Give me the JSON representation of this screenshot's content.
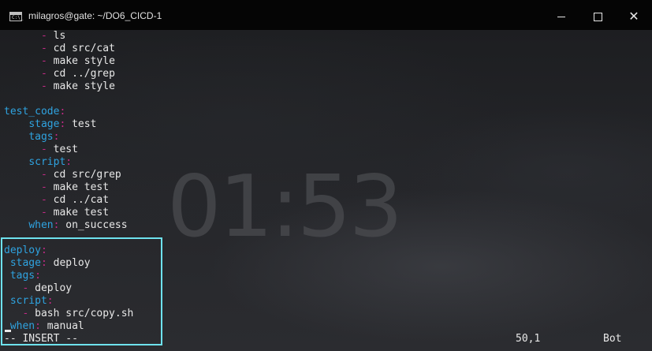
{
  "window": {
    "title": "milagros@gate: ~/DO6_CICD-1",
    "icon_label": "C:\\_",
    "buttons": {
      "minimize": "minimize",
      "maximize": "maximize",
      "close": "✕"
    }
  },
  "background": {
    "clock": "01:53"
  },
  "editor": {
    "lines": [
      [
        {
          "t": "      ",
          "c": "v"
        },
        {
          "t": "- ",
          "c": "d"
        },
        {
          "t": "ls",
          "c": "v"
        }
      ],
      [
        {
          "t": "      ",
          "c": "v"
        },
        {
          "t": "- ",
          "c": "d"
        },
        {
          "t": "cd src/cat",
          "c": "v"
        }
      ],
      [
        {
          "t": "      ",
          "c": "v"
        },
        {
          "t": "- ",
          "c": "d"
        },
        {
          "t": "make style",
          "c": "v"
        }
      ],
      [
        {
          "t": "      ",
          "c": "v"
        },
        {
          "t": "- ",
          "c": "d"
        },
        {
          "t": "cd ../grep",
          "c": "v"
        }
      ],
      [
        {
          "t": "      ",
          "c": "v"
        },
        {
          "t": "- ",
          "c": "d"
        },
        {
          "t": "make style",
          "c": "v"
        }
      ],
      [],
      [
        {
          "t": "test_code",
          "c": "k"
        },
        {
          "t": ":",
          "c": "p"
        }
      ],
      [
        {
          "t": "    ",
          "c": "v"
        },
        {
          "t": "stage",
          "c": "k"
        },
        {
          "t": ": ",
          "c": "p"
        },
        {
          "t": "test",
          "c": "v"
        }
      ],
      [
        {
          "t": "    ",
          "c": "v"
        },
        {
          "t": "tags",
          "c": "k"
        },
        {
          "t": ":",
          "c": "p"
        }
      ],
      [
        {
          "t": "      ",
          "c": "v"
        },
        {
          "t": "- ",
          "c": "d"
        },
        {
          "t": "test",
          "c": "v"
        }
      ],
      [
        {
          "t": "    ",
          "c": "v"
        },
        {
          "t": "script",
          "c": "k"
        },
        {
          "t": ":",
          "c": "p"
        }
      ],
      [
        {
          "t": "      ",
          "c": "v"
        },
        {
          "t": "- ",
          "c": "d"
        },
        {
          "t": "cd src/grep",
          "c": "v"
        }
      ],
      [
        {
          "t": "      ",
          "c": "v"
        },
        {
          "t": "- ",
          "c": "d"
        },
        {
          "t": "make test",
          "c": "v"
        }
      ],
      [
        {
          "t": "      ",
          "c": "v"
        },
        {
          "t": "- ",
          "c": "d"
        },
        {
          "t": "cd ../cat",
          "c": "v"
        }
      ],
      [
        {
          "t": "      ",
          "c": "v"
        },
        {
          "t": "- ",
          "c": "d"
        },
        {
          "t": "make test",
          "c": "v"
        }
      ],
      [
        {
          "t": "    ",
          "c": "v"
        },
        {
          "t": "when",
          "c": "k"
        },
        {
          "t": ": ",
          "c": "p"
        },
        {
          "t": "on_success",
          "c": "v"
        }
      ],
      [],
      [
        {
          "t": "deploy",
          "c": "k"
        },
        {
          "t": ":",
          "c": "p"
        }
      ],
      [
        {
          "t": " ",
          "c": "v"
        },
        {
          "t": "stage",
          "c": "k"
        },
        {
          "t": ": ",
          "c": "p"
        },
        {
          "t": "deploy",
          "c": "v"
        }
      ],
      [
        {
          "t": " ",
          "c": "v"
        },
        {
          "t": "tags",
          "c": "k"
        },
        {
          "t": ":",
          "c": "p"
        }
      ],
      [
        {
          "t": "   ",
          "c": "v"
        },
        {
          "t": "- ",
          "c": "d"
        },
        {
          "t": "deploy",
          "c": "v"
        }
      ],
      [
        {
          "t": " ",
          "c": "v"
        },
        {
          "t": "script",
          "c": "k"
        },
        {
          "t": ":",
          "c": "p"
        }
      ],
      [
        {
          "t": "   ",
          "c": "v"
        },
        {
          "t": "- ",
          "c": "d"
        },
        {
          "t": "bash src/copy.sh",
          "c": "v"
        }
      ],
      [
        {
          "t": " ",
          "c": "v"
        },
        {
          "t": "when",
          "c": "k"
        },
        {
          "t": ": ",
          "c": "p"
        },
        {
          "t": "manual",
          "c": "v"
        }
      ]
    ]
  },
  "status": {
    "mode": "-- INSERT --",
    "position": "50,1",
    "scroll": "Bot"
  },
  "colors": {
    "key": "#2fa3e0",
    "punct": "#c32a86",
    "text": "#e8e8e8",
    "highlight": "#6ee2ee"
  }
}
